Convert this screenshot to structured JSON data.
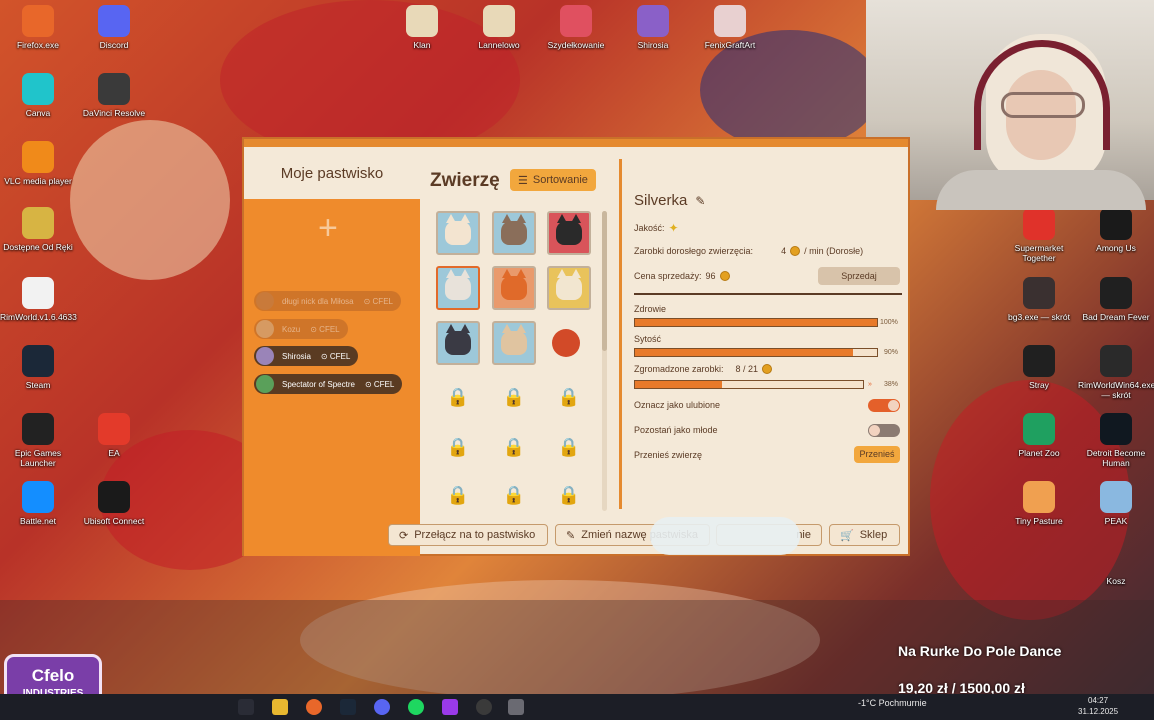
{
  "desktop": {
    "left_icons": [
      {
        "label": "Firefox.exe",
        "color": "#e8672a"
      },
      {
        "label": "Discord",
        "color": "#5865f2"
      },
      {
        "label": "Canva",
        "color": "#20c4cb"
      },
      {
        "label": "DaVinci Resolve",
        "color": "#3a3a3a"
      },
      {
        "label": "VLC media player",
        "color": "#f08a1a"
      },
      {
        "label": "Dostępne Od Ręki",
        "color": "#d7b443"
      },
      {
        "label": "RimWorld.v1.6.4633",
        "color": "#f2f2f2"
      },
      {
        "label": "Steam",
        "color": "#1b2838"
      },
      {
        "label": "Epic Games Launcher",
        "color": "#222222"
      },
      {
        "label": "EA",
        "color": "#e33a2a"
      },
      {
        "label": "Battle.net",
        "color": "#148eff"
      },
      {
        "label": "Ubisoft Connect",
        "color": "#1a1a1a"
      }
    ],
    "top_icons": [
      "Klan",
      "Lannelowo",
      "Szydełkowanie",
      "Shirosia",
      "FenixGraftArt"
    ],
    "right_icons": [
      {
        "label": "Supermarket Together",
        "color": "#e0322a"
      },
      {
        "label": "Among Us",
        "color": "#1a1a1a"
      },
      {
        "label": "bg3.exe — skrót",
        "color": "#3a3030"
      },
      {
        "label": "Bad Dream Fever",
        "color": "#202020"
      },
      {
        "label": "Stray",
        "color": "#202020"
      },
      {
        "label": "RimWorldWin64.exe — skrót",
        "color": "#2a2a2a"
      },
      {
        "label": "Planet Zoo",
        "color": "#1fa060"
      },
      {
        "label": "Detroit Become Human",
        "color": "#101820"
      },
      {
        "label": "Tiny Pasture",
        "color": "#f0a050"
      },
      {
        "label": "PEAK",
        "color": "#8ab8e0"
      }
    ],
    "other_label": "Kosz"
  },
  "game": {
    "left_panel": {
      "title": "Moje pastwisko",
      "friends": [
        {
          "name": "długi nick dla Miłosa",
          "tag": "CFEL",
          "state": "dim"
        },
        {
          "name": "Kozu",
          "tag": "CFEL",
          "state": "dim"
        },
        {
          "name": "Shirosia",
          "tag": "CFEL",
          "state": "on"
        },
        {
          "name": "Spectator of Spectre",
          "tag": "CFEL",
          "state": "on"
        }
      ]
    },
    "animals": {
      "title": "Zwierzę",
      "sort_label": "Sortowanie"
    },
    "detail": {
      "name": "Silverka",
      "quality_label": "Jakość:",
      "earnings_label": "Zarobki dorosłego zwierzęcia:",
      "earnings_value": "4",
      "earnings_unit": "/ min (Dorosłe)",
      "price_label": "Cena sprzedaży:",
      "price_value": "96",
      "sell_label": "Sprzedaj",
      "health_label": "Zdrowie",
      "health_pct": "100%",
      "health": 1.0,
      "satiety_label": "Sytość",
      "satiety_pct": "90%",
      "satiety": 0.9,
      "gathered_label": "Zgromadzone zarobki:",
      "gathered_value": "8 / 21",
      "gathered_pct": "38%",
      "gathered": 0.38,
      "favorite_label": "Oznacz jako ulubione",
      "favorite": true,
      "young_label": "Pozostań jako młode",
      "young": false,
      "move_label": "Przenieś zwierzę",
      "move_button": "Przenieś"
    },
    "bottom": {
      "switch": "Przełącz na to pastwisko",
      "rename": "Zmień nazwę pastwiska",
      "settings_tail": "nie",
      "shop": "Sklep"
    }
  },
  "overlay": {
    "song": "Na Rurke Do Pole Dance",
    "money_current": "19,20 zł",
    "money_sep": "/",
    "money_goal": "1500,00 zł",
    "logo": [
      "Cfelo",
      "INDUSTRIES"
    ]
  },
  "taskbar": {
    "weather": "-1°C Pochmurnie",
    "time": "04:27",
    "date": "31.12.2025"
  }
}
